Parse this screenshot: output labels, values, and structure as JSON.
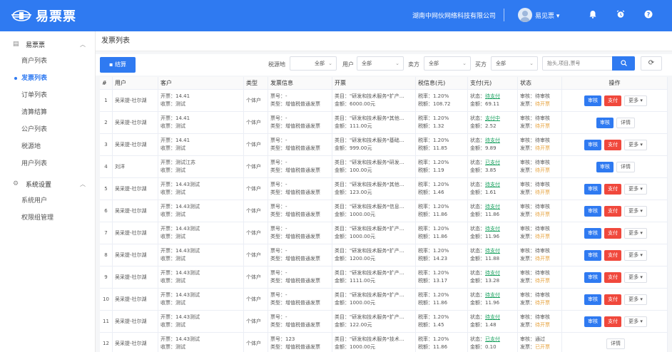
{
  "header": {
    "logo_text": "易票票",
    "company": "湖南中网伙网络科技有限公司",
    "username": "易见票",
    "caret": "▾"
  },
  "sidebar": {
    "groups": [
      {
        "label": "易票票",
        "items": [
          "商户列表",
          "发票列表",
          "订单列表",
          "清算结算",
          "公户列表",
          "税源地",
          "用户列表"
        ]
      },
      {
        "label": "系统设置",
        "items": [
          "系统用户",
          "权限组管理"
        ]
      }
    ],
    "active_item": "发票列表"
  },
  "page": {
    "title": "发票列表",
    "settle_button": "结算",
    "filters": [
      {
        "label": "税源地",
        "value": "全部"
      },
      {
        "label": "用户",
        "value": "全部"
      },
      {
        "label": "卖方",
        "value": "全部"
      },
      {
        "label": "买方",
        "value": "全部"
      }
    ],
    "search_placeholder": "抬头,项目,票号"
  },
  "table": {
    "headers": [
      "#",
      "用户",
      "客户",
      "类型",
      "发票信息",
      "开票",
      "税信息(元)",
      "支付(元)",
      "状态",
      "操作"
    ],
    "rows": [
      {
        "no": "1",
        "user": "吴采提-社尔湖",
        "kp": "开票：14.41",
        "sp": "收票：测试",
        "type": "个体户",
        "ph": "票号：-",
        "lx": "类型：增值税普通发票",
        "lm": "类目：\"研发和技术服务*扩产…",
        "je": "金额：6000.00元",
        "sl": "税率：1.20%",
        "se": "税额：108.72",
        "zt": "状态：",
        "zt_v": "待支付",
        "zj": "金额：69.11",
        "sh": "审核：待审核",
        "fp": "发票：",
        "fp_v": "待开票",
        "ops": [
          "审核",
          "支付",
          "更多 ▾"
        ]
      },
      {
        "no": "2",
        "user": "吴采提-社尔湖",
        "kp": "开票：14.41",
        "sp": "收票：测试",
        "type": "个体户",
        "ph": "票号：-",
        "lx": "类型：增值税普通发票",
        "lm": "类目：\"研发和技术服务*其他…",
        "je": "金额：111.00元",
        "sl": "税率：1.20%",
        "se": "税额：1.32",
        "zt": "状态：",
        "zt_v": "支付中",
        "zj": "金额：2.52",
        "sh": "审核：待审核",
        "fp": "发票：",
        "fp_v": "待开票",
        "ops": [
          "审核",
          "详情"
        ]
      },
      {
        "no": "3",
        "user": "吴采提-社尔湖",
        "kp": "开票：14.41",
        "sp": "收票：测试",
        "type": "个体户",
        "ph": "票号：-",
        "lx": "类型：增值税普通发票",
        "lm": "类目：\"研发和技术服务*基础…",
        "je": "金额：999.00元",
        "sl": "税率：1.20%",
        "se": "税额：11.85",
        "zt": "状态：",
        "zt_v": "待支付",
        "zj": "金额：9.89",
        "sh": "审核：待审核",
        "fp": "发票：",
        "fp_v": "待开票",
        "ops": [
          "审核",
          "支付",
          "更多 ▾"
        ]
      },
      {
        "no": "4",
        "user": "刘洋",
        "kp": "开票：测试江苏",
        "sp": "收票：测试",
        "type": "个体户",
        "ph": "票号：-",
        "lx": "类型：增值税普通发票",
        "lm": "类目：\"研发和技术服务*研发…",
        "je": "金额：100.00元",
        "sl": "税率：1.20%",
        "se": "税额：1.19",
        "zt": "状态：",
        "zt_v": "已支付",
        "zj": "金额：3.85",
        "sh": "审核：待审核",
        "fp": "发票：",
        "fp_v": "待开票",
        "ops": [
          "审核",
          "详情"
        ]
      },
      {
        "no": "5",
        "user": "吴采提-社尔湖",
        "kp": "开票：14.43测试",
        "sp": "收票：测试",
        "type": "个体户",
        "ph": "票号：-",
        "lx": "类型：增值税普通发票",
        "lm": "类目：\"研发和技术服务*其他…",
        "je": "金额：123.00元",
        "sl": "税率：1.20%",
        "se": "税额：1.46",
        "zt": "状态：",
        "zt_v": "待支付",
        "zj": "金额：1.61",
        "sh": "审核：待审核",
        "fp": "发票：",
        "fp_v": "待开票",
        "ops": [
          "审核",
          "支付",
          "更多 ▾"
        ]
      },
      {
        "no": "6",
        "user": "吴采提-社尔湖",
        "kp": "开票：14.43测试",
        "sp": "收票：测试",
        "type": "个体户",
        "ph": "票号：-",
        "lx": "类型：增值税普通发票",
        "lm": "类目：\"研发和技术服务*信息…",
        "je": "金额：1000.00元",
        "sl": "税率：1.20%",
        "se": "税额：11.86",
        "zt": "状态：",
        "zt_v": "待支付",
        "zj": "金额：11.86",
        "sh": "审核：待审核",
        "fp": "发票：",
        "fp_v": "待开票",
        "ops": [
          "审核",
          "支付",
          "更多 ▾"
        ]
      },
      {
        "no": "7",
        "user": "吴采提-社尔湖",
        "kp": "开票：14.43测试",
        "sp": "收票：测试",
        "type": "个体户",
        "ph": "票号：-",
        "lx": "类型：增值税普通发票",
        "lm": "类目：\"研发和技术服务*扩产…",
        "je": "金额：1000.00元",
        "sl": "税率：1.20%",
        "se": "税额：11.86",
        "zt": "状态：",
        "zt_v": "待支付",
        "zj": "金额：11.96",
        "sh": "审核：待审核",
        "fp": "发票：",
        "fp_v": "待开票",
        "ops": [
          "审核",
          "支付",
          "更多 ▾"
        ]
      },
      {
        "no": "8",
        "user": "吴采提-社尔湖",
        "kp": "开票：14.43测试",
        "sp": "收票：测试",
        "type": "个体户",
        "ph": "票号：-",
        "lx": "类型：增值税普通发票",
        "lm": "类目：\"研发和技术服务*扩产…",
        "je": "金额：1200.00元",
        "sl": "税率：1.20%",
        "se": "税额：14.23",
        "zt": "状态：",
        "zt_v": "待支付",
        "zj": "金额：11.88",
        "sh": "审核：待审核",
        "fp": "发票：",
        "fp_v": "待开票",
        "ops": [
          "审核",
          "支付",
          "更多 ▾"
        ]
      },
      {
        "no": "9",
        "user": "吴采提-社尔湖",
        "kp": "开票：14.43测试",
        "sp": "收票：测试",
        "type": "个体户",
        "ph": "票号：-",
        "lx": "类型：增值税普通发票",
        "lm": "类目：\"研发和技术服务*扩产…",
        "je": "金额：1111.00元",
        "sl": "税率：1.20%",
        "se": "税额：13.17",
        "zt": "状态：",
        "zt_v": "待支付",
        "zj": "金额：13.28",
        "sh": "审核：待审核",
        "fp": "发票：",
        "fp_v": "待开票",
        "ops": [
          "审核",
          "支付",
          "更多 ▾"
        ]
      },
      {
        "no": "10",
        "user": "吴采提-社尔湖",
        "kp": "开票：14.43测试",
        "sp": "收票：测试",
        "type": "个体户",
        "ph": "票号：-",
        "lx": "类型：增值税普通发票",
        "lm": "类目：\"研发和技术服务*扩产…",
        "je": "金额：1000.00元",
        "sl": "税率：1.20%",
        "se": "税额：11.86",
        "zt": "状态：",
        "zt_v": "待支付",
        "zj": "金额：11.96",
        "sh": "审核：待审核",
        "fp": "发票：",
        "fp_v": "待开票",
        "ops": [
          "审核",
          "支付",
          "更多 ▾"
        ]
      },
      {
        "no": "11",
        "user": "吴采提-社尔湖",
        "kp": "开票：14.43测试",
        "sp": "收票：测试",
        "type": "个体户",
        "ph": "票号：-",
        "lx": "类型：增值税普通发票",
        "lm": "类目：\"研发和技术服务*扩产…",
        "je": "金额：122.00元",
        "sl": "税率：1.20%",
        "se": "税额：1.45",
        "zt": "状态：",
        "zt_v": "待支付",
        "zj": "金额：1.48",
        "sh": "审核：待审核",
        "fp": "发票：",
        "fp_v": "待开票",
        "ops": [
          "审核",
          "支付",
          "更多 ▾"
        ]
      },
      {
        "no": "12",
        "user": "吴采提-社尔湖",
        "kp": "开票：14.43测试",
        "sp": "收票：测试",
        "type": "个体户",
        "ph": "票号：123",
        "lx": "类型：增值税普通发票",
        "lm": "类目：\"研发和技术服务*技术…",
        "je": "金额：1000.00元",
        "sl": "税率：1.20%",
        "se": "税额：11.86",
        "zt": "状态：",
        "zt_v": "已支付",
        "zj": "金额：0.10",
        "sh": "审核：通过",
        "fp": "发票：",
        "fp_v": "已开票",
        "ops": [
          "详情"
        ]
      }
    ]
  },
  "colors": {
    "primary": "#2f7af1",
    "danger": "#f0483c",
    "success": "#19a15f",
    "warning": "#e6a23c"
  }
}
